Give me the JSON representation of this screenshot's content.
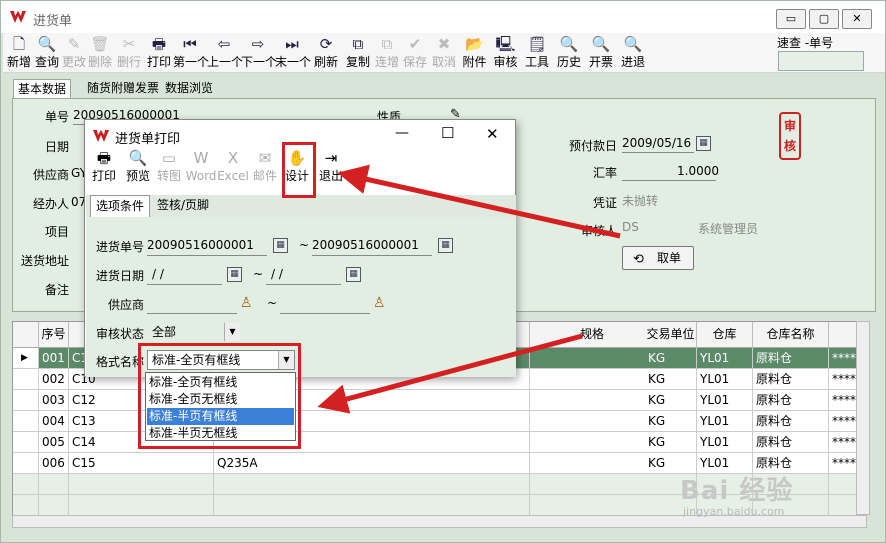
{
  "window": {
    "title": "进货单",
    "controls": [
      "▭",
      "▢",
      "✕"
    ]
  },
  "toolbar": {
    "buttons": [
      {
        "label": "新增",
        "icon": "new-doc-icon",
        "glyph": "🗋",
        "enabled": true
      },
      {
        "label": "查询",
        "icon": "search-icon",
        "glyph": "🔍",
        "enabled": true
      },
      {
        "label": "更改",
        "icon": "edit-icon",
        "glyph": "✎",
        "enabled": false
      },
      {
        "label": "删除",
        "icon": "trash-icon",
        "glyph": "🗑",
        "enabled": false
      },
      {
        "label": "删行",
        "icon": "delete-row-icon",
        "glyph": "✂",
        "enabled": false
      },
      {
        "label": "打印",
        "icon": "printer-icon",
        "glyph": "🖶",
        "enabled": true
      },
      {
        "label": "第一个",
        "icon": "first-icon",
        "glyph": "⏮",
        "enabled": true
      },
      {
        "label": "上一个",
        "icon": "prev-icon",
        "glyph": "⇦",
        "enabled": true
      },
      {
        "label": "下一个",
        "icon": "next-icon",
        "glyph": "⇨",
        "enabled": true
      },
      {
        "label": "末一个",
        "icon": "last-icon",
        "glyph": "⏭",
        "enabled": true
      },
      {
        "label": "刷新",
        "icon": "refresh-icon",
        "glyph": "⟳",
        "enabled": true
      },
      {
        "label": "复制",
        "icon": "copy-icon",
        "glyph": "⧉",
        "enabled": true
      },
      {
        "label": "连增",
        "icon": "continuous-add-icon",
        "glyph": "⧉",
        "enabled": false
      },
      {
        "label": "保存",
        "icon": "check-icon",
        "glyph": "✔",
        "enabled": false
      },
      {
        "label": "取消",
        "icon": "cancel-icon",
        "glyph": "✖",
        "enabled": false
      },
      {
        "label": "附件",
        "icon": "folder-icon",
        "glyph": "📂",
        "enabled": true
      },
      {
        "label": "审核",
        "icon": "audit-icon",
        "glyph": "🖳",
        "enabled": true
      },
      {
        "label": "工具",
        "icon": "tools-icon",
        "glyph": "🗒",
        "enabled": true
      },
      {
        "label": "历史",
        "icon": "history-search-icon",
        "glyph": "🔍",
        "enabled": true
      },
      {
        "label": "开票",
        "icon": "invoice-search-icon",
        "glyph": "🔍",
        "enabled": true
      },
      {
        "label": "进退",
        "icon": "return-search-icon",
        "glyph": "🔍",
        "enabled": true
      }
    ],
    "quick_search_label": "速查  -单号"
  },
  "tabs": [
    "基本数据",
    "随货附赠发票",
    "数据浏览"
  ],
  "form": {
    "order_no_label": "单号",
    "order_no": "20090516000001",
    "date_label": "日期",
    "supplier_label": "供应商",
    "supplier": "GY",
    "handler_label": "经办人",
    "handler": "07",
    "project_label": "项目",
    "address_label": "送货地址",
    "remark_label": "备注",
    "nature_label": "性质",
    "prepay_date_label": "预付款日",
    "prepay_date": "2009/05/16",
    "rate_label": "汇率",
    "rate": "1.0000",
    "voucher_label": "凭证",
    "voucher": "未抛转",
    "auditor_label": "审核人",
    "auditor_code": "DS",
    "auditor_name": "系统管理员",
    "stamp": "审核",
    "cancel_label": "取单"
  },
  "grid": {
    "headers": [
      "序号",
      "",
      "",
      "规格",
      "交易单位",
      "仓库",
      "仓库名称",
      ""
    ],
    "rows": [
      {
        "seq": "001",
        "code": "C1",
        "name": "",
        "unit": "KG",
        "wh": "YL01",
        "whname": "原料仓",
        "extra": "****"
      },
      {
        "seq": "002",
        "code": "C10",
        "name": "",
        "unit": "KG",
        "wh": "YL01",
        "whname": "原料仓",
        "extra": "****"
      },
      {
        "seq": "003",
        "code": "C12",
        "name": "",
        "unit": "KG",
        "wh": "YL01",
        "whname": "原料仓",
        "extra": "****"
      },
      {
        "seq": "004",
        "code": "C13",
        "name": "",
        "unit": "KG",
        "wh": "YL01",
        "whname": "原料仓",
        "extra": "****"
      },
      {
        "seq": "005",
        "code": "C14",
        "name": "",
        "unit": "KG",
        "wh": "YL01",
        "whname": "原料仓",
        "extra": "****"
      },
      {
        "seq": "006",
        "code": "C15",
        "name": "Q235A",
        "unit": "KG",
        "wh": "YL01",
        "whname": "原料仓",
        "extra": "****"
      }
    ]
  },
  "dialog": {
    "title": "进货单打印",
    "min": "—",
    "max": "☐",
    "close": "✕",
    "buttons": [
      {
        "label": "打印",
        "icon": "printer-icon",
        "glyph": "🖶",
        "enabled": true
      },
      {
        "label": "预览",
        "icon": "preview-icon",
        "glyph": "🔍",
        "enabled": true
      },
      {
        "label": "转图",
        "icon": "image-icon",
        "glyph": "▭",
        "enabled": false
      },
      {
        "label": "Word",
        "icon": "word-icon",
        "glyph": "W",
        "enabled": false
      },
      {
        "label": "Excel",
        "icon": "excel-icon",
        "glyph": "X",
        "enabled": false
      },
      {
        "label": "邮件",
        "icon": "mail-icon",
        "glyph": "✉",
        "enabled": false
      },
      {
        "label": "设计",
        "icon": "design-icon",
        "glyph": "✋",
        "enabled": true
      },
      {
        "label": "退出",
        "icon": "exit-icon",
        "glyph": "⇥",
        "enabled": true
      }
    ],
    "tabs": [
      "选项条件",
      "签核/页脚"
    ],
    "order_label": "进货单号",
    "order_from": "20090516000001",
    "order_to": "20090516000001",
    "date_label": "进货日期",
    "date_from": " / /",
    "date_to": " / /",
    "supplier_label": "供应商",
    "audit_label": "审核状态",
    "audit_value": "全部",
    "format_label": "格式名称",
    "format_value": "标准-全页有框线",
    "tilde": "~",
    "format_options": [
      "标准-全页有框线",
      "标准-全页无框线",
      "标准-半页有框线",
      "标准-半页无框线"
    ],
    "selected_option": 2
  },
  "watermark": {
    "text": "Bai 经验",
    "sub": "jingyan.baidu.com"
  },
  "colors": {
    "annotation_red": "#d42020",
    "selected_row": "#5a8a68",
    "highlight": "#3c7fd6"
  }
}
